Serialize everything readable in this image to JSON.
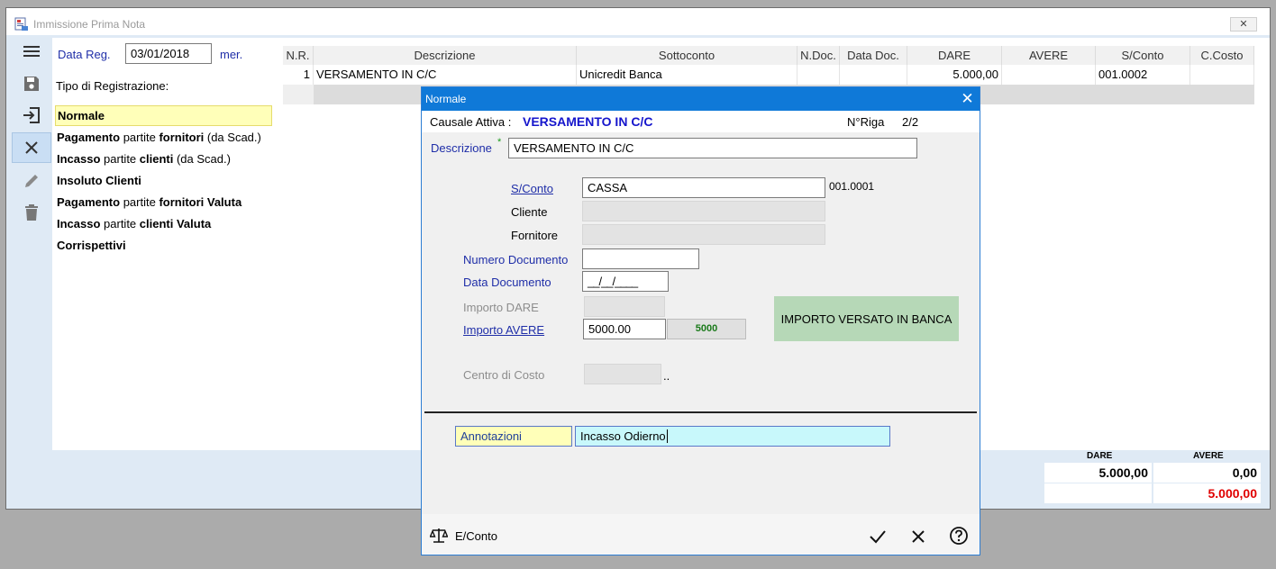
{
  "window": {
    "title": "Immissione Prima Nota",
    "close": "✕"
  },
  "toolbar": [
    {
      "name": "menu-icon"
    },
    {
      "name": "save-icon"
    },
    {
      "name": "login-icon"
    },
    {
      "name": "close-icon"
    },
    {
      "name": "edit-icon"
    },
    {
      "name": "trash-icon"
    }
  ],
  "form": {
    "data_reg_label": "Data Reg.",
    "data_reg_value": "03/01/2018",
    "weekday": "mer.",
    "tipo_label": "Tipo di Registrazione:"
  },
  "registration_types": [
    {
      "parts": [
        {
          "t": "Normale",
          "b": true
        }
      ],
      "selected": true
    },
    {
      "parts": [
        {
          "t": "Pagamento",
          "b": true
        },
        {
          "t": " partite ",
          "b": false
        },
        {
          "t": "fornitori",
          "b": true
        },
        {
          "t": " (da Scad.)",
          "b": false
        }
      ]
    },
    {
      "parts": [
        {
          "t": "Incasso",
          "b": true
        },
        {
          "t": " partite ",
          "b": false
        },
        {
          "t": "clienti",
          "b": true
        },
        {
          "t": " (da Scad.)",
          "b": false
        }
      ]
    },
    {
      "parts": [
        {
          "t": "Insoluto Clienti",
          "b": true
        }
      ]
    },
    {
      "parts": [
        {
          "t": "Pagamento",
          "b": true
        },
        {
          "t": " partite ",
          "b": false
        },
        {
          "t": "fornitori Valuta",
          "b": true
        }
      ]
    },
    {
      "parts": [
        {
          "t": "Incasso",
          "b": true
        },
        {
          "t": " partite ",
          "b": false
        },
        {
          "t": "clienti Valuta",
          "b": true
        }
      ]
    },
    {
      "parts": [
        {
          "t": "Corrispettivi",
          "b": true
        }
      ]
    }
  ],
  "grid": {
    "columns": [
      "N.R.",
      "Descrizione",
      "Sottoconto",
      "N.Doc.",
      "Data Doc.",
      "DARE",
      "AVERE",
      "S/Conto",
      "C.Costo"
    ],
    "rows": [
      [
        "1",
        "VERSAMENTO IN C/C",
        "Unicredit Banca",
        "",
        "",
        "5.000,00",
        "",
        "001.0002",
        ""
      ]
    ]
  },
  "totals": {
    "dare_label": "DARE",
    "avere_label": "AVERE",
    "dare": "5.000,00",
    "avere": "0,00",
    "balance": "5.000,00"
  },
  "dialog": {
    "title": "Normale",
    "close": "✕",
    "causale_label": "Causale Attiva :",
    "causale_value": "VERSAMENTO IN C/C",
    "nriga_label": "N°Riga",
    "nriga_value": "2/2",
    "descrizione_label": "Descrizione",
    "required_mark": "*",
    "descrizione_value": "VERSAMENTO IN C/C",
    "sconto_label": "S/Conto",
    "sconto_value": "CASSA",
    "sconto_code": "001.0001",
    "cliente_label": "Cliente",
    "fornitore_label": "Fornitore",
    "numdoc_label": "Numero Documento",
    "numdoc_value": "",
    "datadoc_label": "Data Documento",
    "datadoc_value": "__/__/____",
    "importo_dare_label": "Importo DARE",
    "importo_avere_label": "Importo AVERE",
    "importo_avere_value": "5000.00",
    "importo_avere_preview": "5000",
    "green_button": "IMPORTO VERSATO IN BANCA",
    "centro_label": "Centro di Costo",
    "centro_dots": "..",
    "annotazioni_label": "Annotazioni",
    "annotazioni_value": "Incasso Odierno",
    "econto_label": "E/Conto"
  },
  "colors": {
    "accent": "#0f79d8",
    "link_blue": "#1f2ea8",
    "highlight_yellow": "#ffffb9",
    "annot_cyan": "#c8f8fb",
    "green_button": "#b6d8b7",
    "negative_red": "#e00000"
  }
}
